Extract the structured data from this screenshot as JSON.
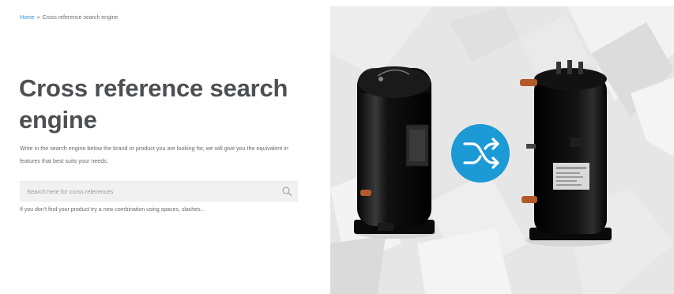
{
  "breadcrumb": {
    "home": "Home",
    "separator": "»",
    "current": "Cross reference search engine"
  },
  "page": {
    "title": "Cross reference search engine",
    "description": "Write in the search engine below the brand or product you are looking for, we will give you the equivalent in features that best suits your needs."
  },
  "search": {
    "placeholder": "Search here for cross references",
    "value": "",
    "hint": "If you don't find your product try a new combination using spaces, slashes..."
  },
  "hero": {
    "swap_icon": "shuffle-icon",
    "accent_color": "#1b9ad6"
  },
  "colors": {
    "link": "#2f8ed6",
    "title": "#4d4f53",
    "hero_bg": "#e6e6e6"
  }
}
